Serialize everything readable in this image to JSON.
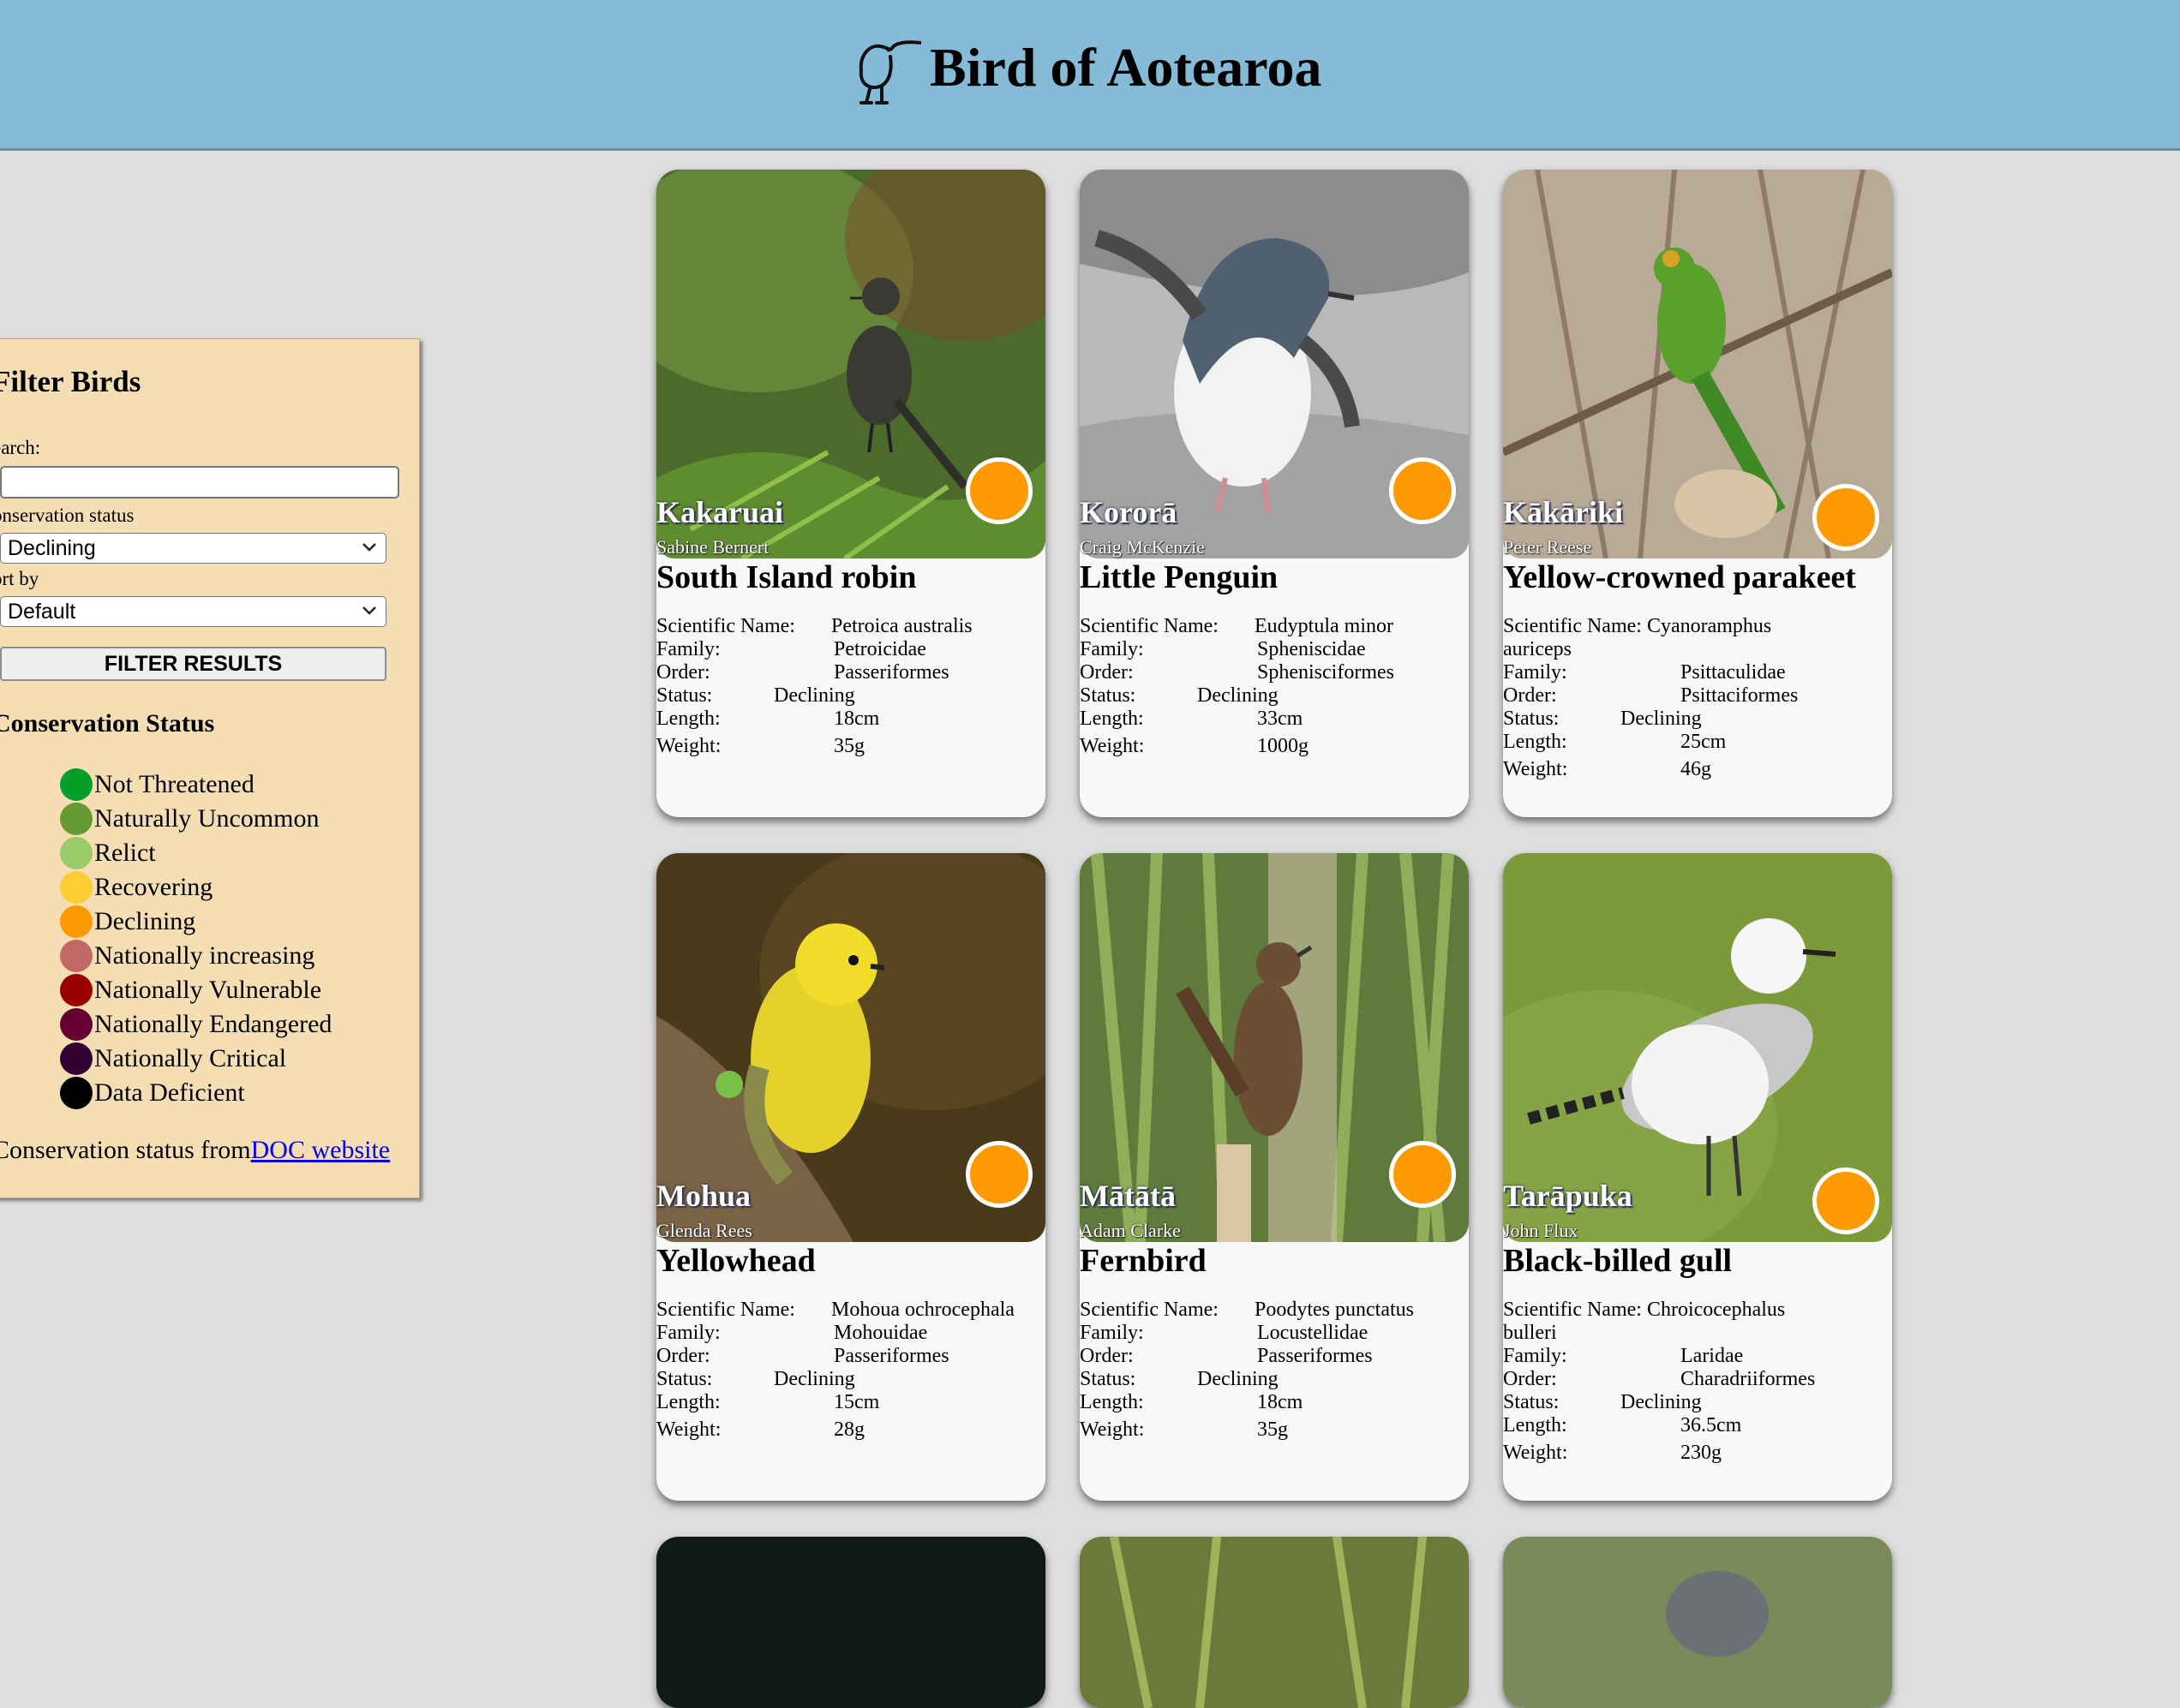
{
  "header": {
    "title": "Bird of Aotearoa"
  },
  "sidebar": {
    "title": "Filter Birds",
    "search_label": "earch:",
    "search_value": "",
    "conservation_label": "onservation status",
    "conservation_value": "Declining",
    "sort_label": "ort by",
    "sort_value": "Default",
    "filter_button": "FILTER RESULTS",
    "legend_title": "Conservation Status",
    "legend": [
      {
        "label": "Not Threatened",
        "color": "#02a028"
      },
      {
        "label": "Naturally Uncommon",
        "color": "#649a31"
      },
      {
        "label": "Relict",
        "color": "#99cb68"
      },
      {
        "label": "Recovering",
        "color": "#fecc33"
      },
      {
        "label": "Declining",
        "color": "#fe9a01"
      },
      {
        "label": "Nationally increasing",
        "color": "#c26967"
      },
      {
        "label": "Nationally Vulnerable",
        "color": "#9b0000"
      },
      {
        "label": "Nationally Endangered",
        "color": "#660032"
      },
      {
        "label": "Nationally Critical",
        "color": "#320033"
      },
      {
        "label": "Data Deficient",
        "color": "#000000"
      }
    ],
    "source_prefix": "Conservation status from",
    "source_link": "DOC website"
  },
  "field_labels": {
    "scientific": "Scientific Name:",
    "family": "Family:",
    "order": "Order:",
    "status": "Status:",
    "length": "Length:",
    "weight": "Weight:"
  },
  "birds": [
    {
      "maori": "Kakaruai",
      "credit": "Sabine Bernert",
      "english": "South Island robin",
      "scientific": "Petroica australis",
      "family": "Petroicidae",
      "order": "Passeriformes",
      "status": "Declining",
      "length": "18cm",
      "weight": "35g",
      "status_color": "#fe9a01"
    },
    {
      "maori": "Kororā",
      "credit": "Craig McKenzie",
      "english": "Little Penguin",
      "scientific": "Eudyptula minor",
      "family": "Spheniscidae",
      "order": "Sphenisciformes",
      "status": "Declining",
      "length": "33cm",
      "weight": "1000g",
      "status_color": "#fe9a01"
    },
    {
      "maori": "Kākāriki",
      "credit": "Peter Reese",
      "english": "Yellow-crowned parakeet",
      "scientific_1": "Scientific Name: Cyanoramphus",
      "scientific_2": "auriceps",
      "family": "Psittaculidae",
      "order": "Psittaciformes",
      "status": "Declining",
      "length": "25cm",
      "weight": "46g",
      "status_color": "#fe9a01"
    },
    {
      "maori": "Mohua",
      "credit": "Glenda Rees",
      "english": "Yellowhead",
      "scientific": "Mohoua ochrocephala",
      "family": "Mohouidae",
      "order": "Passeriformes",
      "status": "Declining",
      "length": "15cm",
      "weight": "28g",
      "status_color": "#fe9a01"
    },
    {
      "maori": "Mātātā",
      "credit": "Adam Clarke",
      "english": "Fernbird",
      "scientific": "Poodytes punctatus",
      "family": "Locustellidae",
      "order": "Passeriformes",
      "status": "Declining",
      "length": "18cm",
      "weight": "35g",
      "status_color": "#fe9a01"
    },
    {
      "maori": "Tarāpuka",
      "credit": "John Flux",
      "english": "Black-billed gull",
      "scientific_1": "Scientific Name: Chroicocephalus",
      "scientific_2": "bulleri",
      "family": "Laridae",
      "order": "Charadriiformes",
      "status": "Declining",
      "length": "36.5cm",
      "weight": "230g",
      "status_color": "#fe9a01"
    }
  ]
}
